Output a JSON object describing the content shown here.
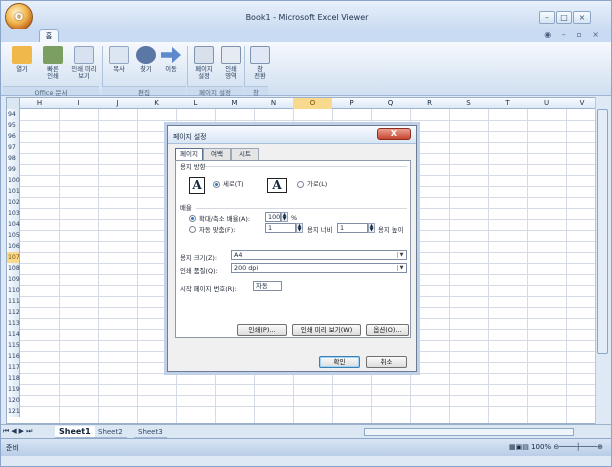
{
  "window": {
    "title": "Book1 - Microsoft Excel Viewer",
    "office_button": "O"
  },
  "ribbon": {
    "tabs": [
      {
        "label": "홈"
      }
    ],
    "buttons": [
      {
        "label": "열기",
        "color": "#f0b84b"
      },
      {
        "label": "빠른\n인쇄",
        "color": "#7b9f62"
      },
      {
        "label": "인쇄 미리\n보기",
        "color": "#d7e1ef"
      },
      {
        "label": "복사",
        "color": "#dce6f2"
      },
      {
        "label": "찾기",
        "color": "#5b77a5"
      },
      {
        "label": "이동",
        "color": "#5e89cc"
      },
      {
        "label": "페이지\n설정",
        "color": "#d7e0eb"
      },
      {
        "label": "인쇄\n영역",
        "color": "#e6ebf2"
      },
      {
        "label": "창\n전환",
        "color": "#dfe8f4"
      }
    ],
    "groups": [
      "Office 문서",
      "편집",
      "페이지 설정",
      "창"
    ]
  },
  "sheet": {
    "columns": [
      "H",
      "I",
      "J",
      "K",
      "L",
      "M",
      "N",
      "O",
      "P",
      "Q",
      "R",
      "S",
      "T",
      "U",
      "V"
    ],
    "selected_column": "O",
    "selected_row": "107",
    "rows": [
      "94",
      "95",
      "96",
      "97",
      "98",
      "99",
      "100",
      "101",
      "102",
      "103",
      "104",
      "105",
      "106",
      "107",
      "108",
      "109",
      "110",
      "111",
      "112",
      "113",
      "114",
      "115",
      "116",
      "117",
      "118",
      "119",
      "120",
      "121"
    ],
    "tabs": [
      "Sheet1",
      "Sheet2",
      "Sheet3"
    ],
    "active_tab": "Sheet1"
  },
  "status": {
    "text": "준비",
    "zoom": "100%"
  },
  "dialog": {
    "title": "페이지 설정",
    "close_label": "X",
    "tabs": [
      "페이지",
      "여백",
      "시트"
    ],
    "orientation_label": "용지 방향",
    "portrait": "세로(T)",
    "landscape": "가로(L)",
    "scaling_label": "배율",
    "adjust_label": "확대/축소 배율(A):",
    "adjust_value": "100",
    "adjust_unit": "%",
    "fit_label": "자동 맞춤(F):",
    "fit_width_value": "1",
    "fit_width_label": "용지 너비",
    "fit_height_value": "1",
    "fit_height_label": "용지 높이",
    "paper_label": "용지 크기(Z):",
    "paper_value": "A4",
    "quality_label": "인쇄 품질(Q):",
    "quality_value": "200 dpi",
    "first_page_label": "시작 페이지 번호(R):",
    "first_page_value": "자동",
    "print_button": "인쇄(P)...",
    "preview_button": "인쇄 미리 보기(W)",
    "options_button": "옵션(O)...",
    "ok_button": "확인",
    "cancel_button": "취소"
  }
}
